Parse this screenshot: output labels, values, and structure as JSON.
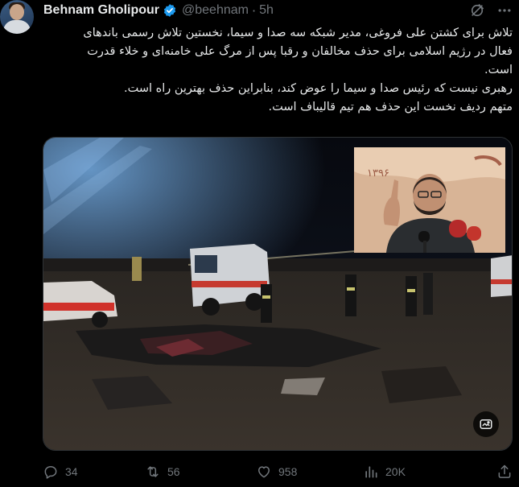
{
  "tweet": {
    "author_name": "Behnam Gholipour",
    "handle": "@beehnam",
    "separator": "·",
    "time": "5h",
    "lines": [
      "تلاش برای کشتن علی فروغی، مدیر شبکه سه صدا و سیما، نخستین تلاش رسمی باندهای",
      "فعال در رژیم اسلامی برای حذف مخالفان و رقبا پس از مرگ علی خامنه‌ای و خلاء قدرت",
      "است.",
      "رهبری نیست که رئیس صدا و سیما را عوض کند، بنابراین حذف بهترین راه است.",
      "متهم ردیف نخست این حذف هم تیم قالیباف است."
    ],
    "inset_year": "۱۳۹۶"
  },
  "actions": {
    "replies": "34",
    "reposts": "56",
    "likes": "958",
    "views": "20K"
  },
  "colors": {
    "background": "#000000",
    "text": "#e7e9ea",
    "secondary": "#71767b",
    "verified": "#1d9bf0"
  },
  "icons": {
    "header": [
      "grok-icon",
      "more-icon"
    ],
    "verified": "verified-badge-icon",
    "actions": [
      "reply-icon",
      "repost-icon",
      "like-icon",
      "views-icon",
      "share-icon"
    ],
    "media": "alt-text-icon"
  }
}
